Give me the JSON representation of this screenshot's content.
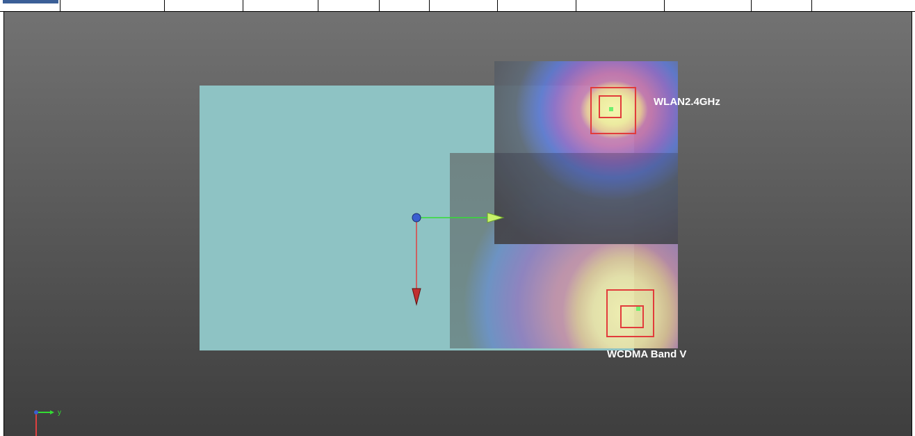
{
  "toolbar": {
    "active_tab_color": "#3b5f97"
  },
  "scene": {
    "background_gradient": [
      "#727272",
      "#3e3e3e"
    ],
    "plate_color": "#8ec3c4",
    "antennas": [
      {
        "label": "WLAN2.4GHz"
      },
      {
        "label": "WCDMA Band V"
      }
    ],
    "gizmo": {
      "origin_color": "#3a5fd0",
      "y_axis_color": "#33dd33",
      "z_axis_color": "#e04040"
    }
  },
  "orientation_triad": {
    "y_label": "y"
  }
}
